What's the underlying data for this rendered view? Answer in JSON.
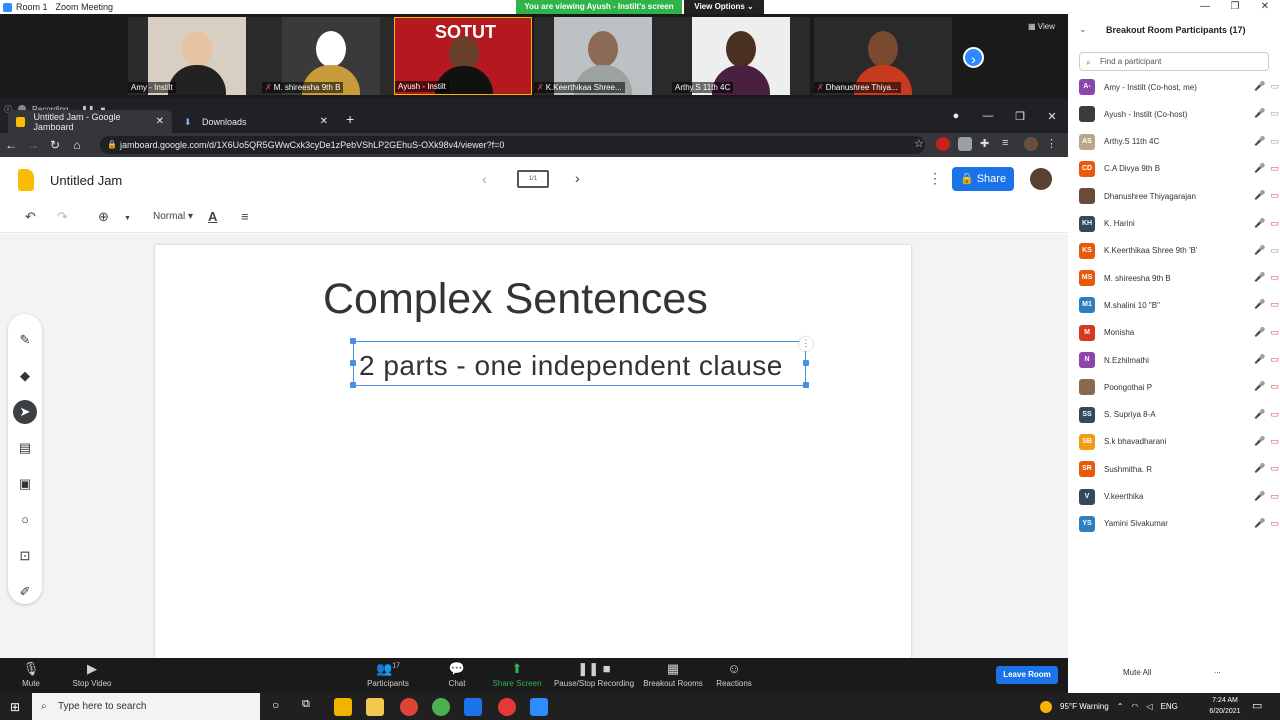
{
  "zoom": {
    "room_label": "Room 1",
    "meeting_title": "Zoom Meeting",
    "viewing_banner": "You are viewing Ayush - Instilt's screen",
    "view_options": "View Options ⌄",
    "view_label": "View",
    "window_controls": [
      "—",
      "❐",
      "✕"
    ]
  },
  "video_tiles": [
    {
      "name": "Amy - Instilt",
      "muted": false
    },
    {
      "name": "M. shireesha 9th B",
      "muted": true
    },
    {
      "name": "Ayush - Instilt",
      "muted": false,
      "overlay": "SOTUT"
    },
    {
      "name": "K.Keerthikaa Shree...",
      "muted": true
    },
    {
      "name": "Arthy.S 11th 4C",
      "muted": false
    },
    {
      "name": "Dhanushree Thiya...",
      "muted": true
    }
  ],
  "browser": {
    "recording_label": "Recording...",
    "tabs": [
      {
        "title": "Untitled Jam - Google Jamboard",
        "close": "✕"
      },
      {
        "title": "Downloads",
        "close": "✕"
      }
    ],
    "new_tab": "+",
    "url": "jamboard.google.com/d/1X6Uo5QR5GWwCxk3cyDe1zPebVShLP2GEhuS-OXk98v4/viewer?f=0",
    "window_controls": [
      "—",
      "❐",
      "✕"
    ]
  },
  "jamboard": {
    "title": "Untitled Jam",
    "frame_indicator": "1/1",
    "share_label": "Share",
    "font_style": "Normal",
    "slide_title": "Complex Sentences",
    "text_box": "2 parts - one independent clause"
  },
  "participants_panel": {
    "title": "Breakout Room Participants (17)",
    "search_placeholder": "Find a participant",
    "mute_all": "Mute All",
    "more": "...",
    "participants": [
      {
        "initials": "A-",
        "name": "Amy - Instilt (Co-host, me)",
        "color": "#8e44ad"
      },
      {
        "initials": "",
        "name": "Ayush - Instilt (Co-host)",
        "color": "#3c3c3c"
      },
      {
        "initials": "AS",
        "name": "Arthy.S 11th 4C",
        "color": "#b7a88a"
      },
      {
        "initials": "CD",
        "name": "C.A Divya 9th B",
        "color": "#e8590c"
      },
      {
        "initials": "",
        "name": "Dhanushree Thiyagarajan",
        "color": "#6b4a3a"
      },
      {
        "initials": "KH",
        "name": "K. Harini",
        "color": "#34495e"
      },
      {
        "initials": "KS",
        "name": "K.Keerthikaa Shree 9th 'B'",
        "color": "#e8590c"
      },
      {
        "initials": "MS",
        "name": "M. shireesha 9th B",
        "color": "#e8590c"
      },
      {
        "initials": "M1",
        "name": "M.shalini  10 \"B\"",
        "color": "#2f7fbf"
      },
      {
        "initials": "M",
        "name": "Monisha",
        "color": "#d9381e"
      },
      {
        "initials": "N",
        "name": "N.Ezhilmathi",
        "color": "#8e44ad"
      },
      {
        "initials": "",
        "name": "Poongothai P",
        "color": "#8a6a4a"
      },
      {
        "initials": "SS",
        "name": "S. Supriya 8-A",
        "color": "#34495e"
      },
      {
        "initials": "SB",
        "name": "S.k bhavadharani",
        "color": "#f39c12"
      },
      {
        "initials": "SR",
        "name": "Sushmitha. R",
        "color": "#e8590c"
      },
      {
        "initials": "V",
        "name": "V.keerthika",
        "color": "#34495e"
      },
      {
        "initials": "YS",
        "name": "Yamini Sivakumar",
        "color": "#2f7fbf"
      }
    ]
  },
  "zoom_controls": {
    "mute": "Mute",
    "stop_video": "Stop Video",
    "participants": "Participants",
    "participants_count": "17",
    "chat": "Chat",
    "share_screen": "Share Screen",
    "record": "Pause/Stop Recording",
    "breakout": "Breakout Rooms",
    "reactions": "Reactions",
    "leave_room": "Leave Room"
  },
  "taskbar": {
    "search_placeholder": "Type here to search",
    "weather": "95°F  Warning",
    "language": "ENG",
    "time": "7:24 AM",
    "date": "6/20/2021"
  }
}
